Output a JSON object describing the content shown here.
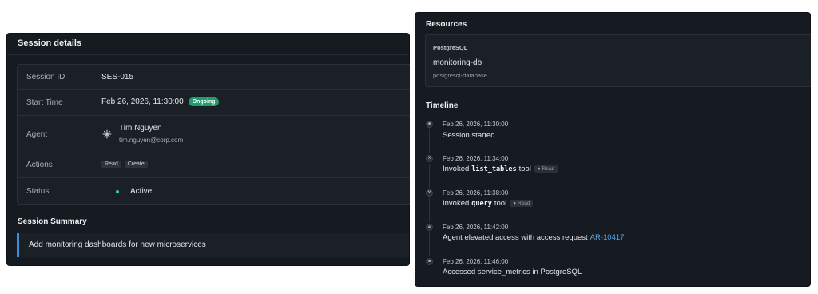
{
  "session": {
    "title": "Session details",
    "rows": {
      "session_id": {
        "label": "Session ID",
        "value": "SES-015"
      },
      "start_time": {
        "label": "Start Time",
        "value": "Feb 26, 2026, 11:30:00",
        "badge": "Ongoing"
      },
      "agent": {
        "label": "Agent",
        "name": "Tim Nguyen",
        "email": "tim.nguyen@corp.com"
      },
      "actions": {
        "label": "Actions",
        "tags": [
          "Read",
          "Create"
        ]
      },
      "status": {
        "label": "Status",
        "value": "Active"
      }
    },
    "summary_title": "Session Summary",
    "summary_text": "Add monitoring dashboards for new microservices"
  },
  "resources": {
    "title": "Resources",
    "card": {
      "type": "PostgreSQL",
      "name": "monitoring-db",
      "kind": "postgresql-database"
    }
  },
  "timeline": {
    "title": "Timeline",
    "events": [
      {
        "time": "Feb 26, 2026, 11:30:00",
        "text": "Session started"
      },
      {
        "time": "Feb 26, 2026, 11:34:00",
        "prefix": "Invoked",
        "tool": "list_tables",
        "suffix": "tool",
        "tag": "Read"
      },
      {
        "time": "Feb 26, 2026, 11:38:00",
        "prefix": "Invoked",
        "tool": "query",
        "suffix": "tool",
        "tag": "Read"
      },
      {
        "time": "Feb 26, 2026, 11:42:00",
        "text": "Agent elevated access with access request",
        "link": "AR-10417"
      },
      {
        "time": "Feb 26, 2026, 11:46:00",
        "text": "Accessed service_metrics in PostgreSQL"
      }
    ]
  },
  "colors": {
    "panel": "#161a21",
    "ongoing": "#1f9d6e",
    "active_dot": "#2fd28f",
    "link": "#5aa8e6",
    "summary_accent": "#3a8fd6"
  }
}
